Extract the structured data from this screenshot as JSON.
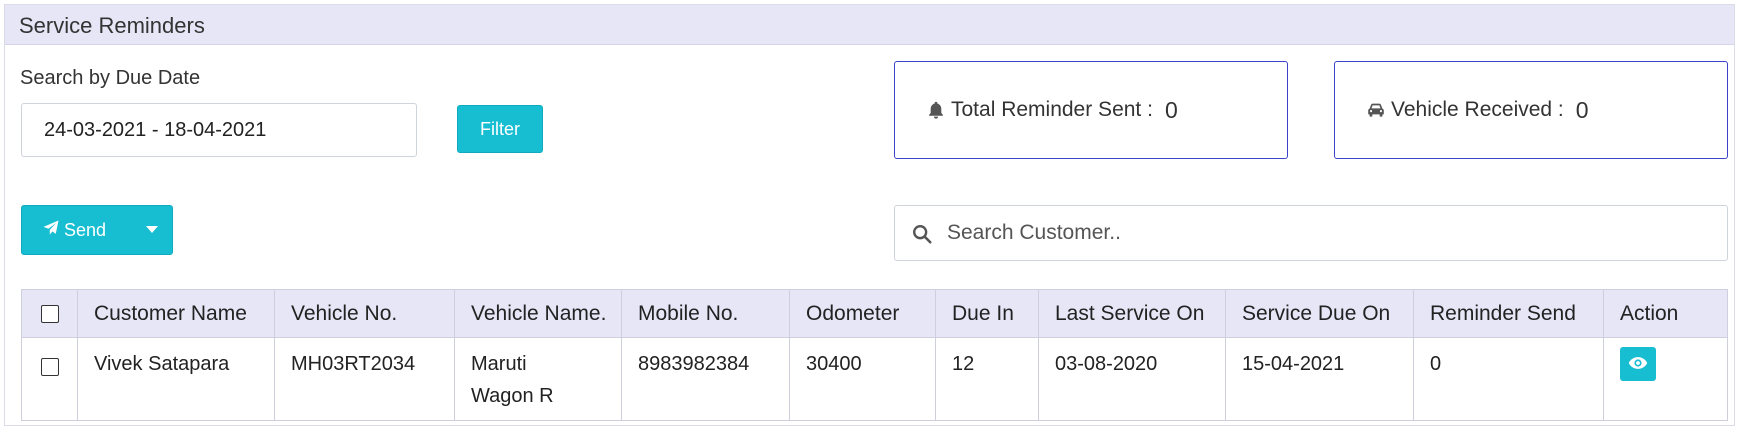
{
  "panel": {
    "title": "Service Reminders"
  },
  "filter": {
    "label": "Search by Due Date",
    "date_range": "24-03-2021 - 18-04-2021",
    "button_label": "Filter"
  },
  "stats": {
    "reminders": {
      "label": "Total Reminder Sent :",
      "value": "0",
      "icon": "bell-icon"
    },
    "received": {
      "label": "Vehicle Received :",
      "value": "0",
      "icon": "car-icon"
    }
  },
  "actions": {
    "send_label": "Send",
    "send_icon": "paper-plane-icon"
  },
  "search": {
    "placeholder": "Search Customer..",
    "icon": "search-icon"
  },
  "table": {
    "headers": {
      "customer_name": "Customer Name",
      "vehicle_no": "Vehicle No.",
      "vehicle_name": "Vehicle Name.",
      "mobile_no": "Mobile No.",
      "odometer": "Odometer",
      "due_in": "Due In",
      "last_service_on": "Last Service On",
      "service_due_on": "Service Due On",
      "reminder_send": "Reminder Send",
      "action": "Action"
    },
    "rows": [
      {
        "customer_name": "Vivek Satapara",
        "vehicle_no": "MH03RT2034",
        "vehicle_name_line1": "Maruti",
        "vehicle_name_line2": "Wagon R",
        "mobile_no": "8983982384",
        "odometer": "30400",
        "due_in": "12",
        "last_service_on": "03-08-2020",
        "service_due_on": "15-04-2021",
        "reminder_send": "0",
        "action_icon": "eye-icon"
      }
    ]
  },
  "colors": {
    "accent": "#17bed2",
    "header_bg": "#e6e6f7",
    "stat_border": "#3b43c9"
  }
}
